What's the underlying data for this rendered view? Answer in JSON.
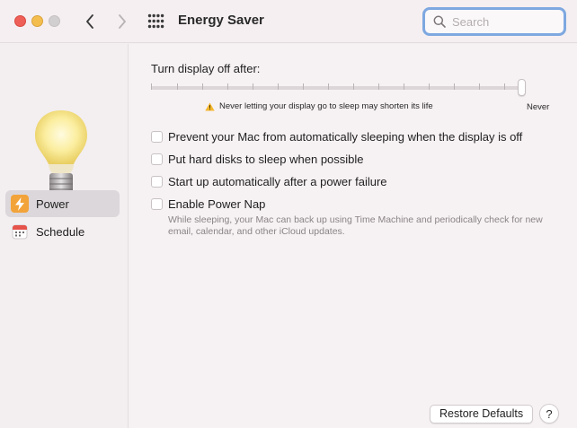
{
  "window": {
    "title": "Energy Saver",
    "search_placeholder": "Search"
  },
  "sidebar": {
    "items": [
      {
        "label": "Power",
        "icon": "power-bolt-icon",
        "selected": true
      },
      {
        "label": "Schedule",
        "icon": "calendar-icon",
        "selected": false
      }
    ]
  },
  "main": {
    "display_off_label": "Turn display off after:",
    "slider_value_label": "Never",
    "slider_position_fraction": 1.0,
    "warning_text": "Never letting your display go to sleep may shorten its life",
    "options": [
      {
        "label": "Prevent your Mac from automatically sleeping when the display is off",
        "checked": false
      },
      {
        "label": "Put hard disks to sleep when possible",
        "checked": false
      },
      {
        "label": "Start up automatically after a power failure",
        "checked": false
      },
      {
        "label": "Enable Power Nap",
        "checked": false
      }
    ],
    "power_nap_description": "While sleeping, your Mac can back up using Time Machine and periodically check for new email, calendar, and other iCloud updates.",
    "restore_defaults_label": "Restore Defaults",
    "help_label": "?"
  },
  "colors": {
    "accent_search_border": "#7ea8e0",
    "power_icon": "#f2a33a",
    "warning_icon": "#f5b82e"
  }
}
